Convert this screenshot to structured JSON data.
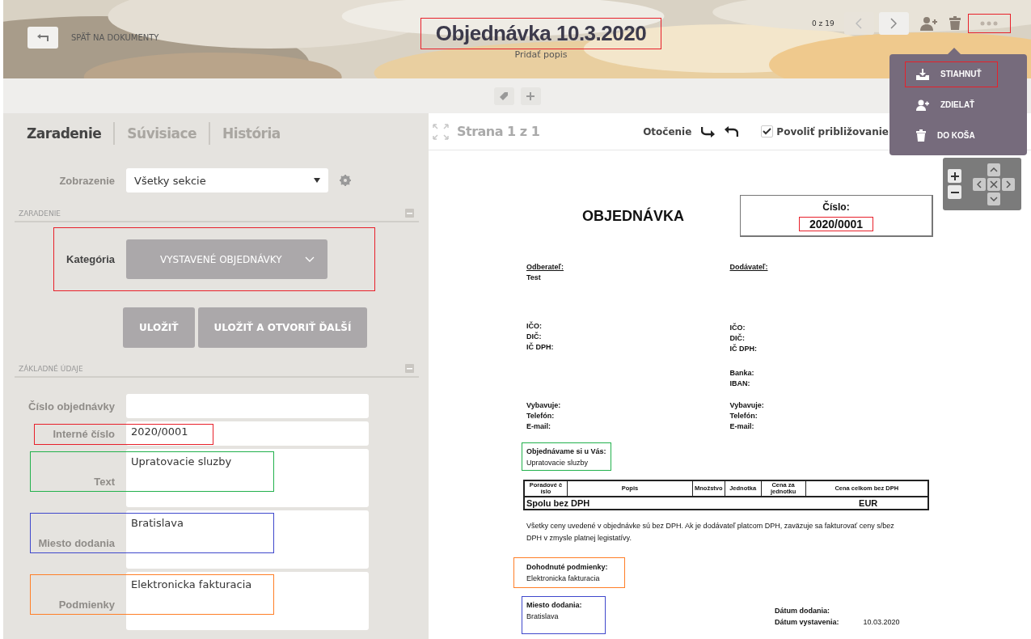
{
  "header": {
    "back_label": "SPÄŤ NA DOKUMENTY",
    "title": "Objednávka 10.3.2020",
    "title_highlight": {
      "color": "#e8202a"
    },
    "subtitle": "Pridať popis",
    "counter": "0 z 19",
    "more_highlight": {
      "color": "#e8202a"
    }
  },
  "more_menu": [
    {
      "label": "STIAHNUŤ",
      "kind": "download",
      "highlight": {
        "color": "#e8202a"
      }
    },
    {
      "label": "ZDIELAŤ",
      "kind": "share"
    },
    {
      "label": "DO KOŠA",
      "kind": "trash"
    }
  ],
  "tabs": [
    {
      "label": "Zaradenie",
      "selected": true
    },
    {
      "label": "Súvisiace",
      "selected": false
    },
    {
      "label": "História",
      "selected": false
    }
  ],
  "view": {
    "label": "Zobrazenie",
    "value": "Všetky sekcie"
  },
  "section_1": "ZARADENIE",
  "category": {
    "label": "Kategória",
    "value": "VYSTAVENÉ OBJEDNÁVKY",
    "highlight": {
      "color": "#e8202a"
    }
  },
  "buttons": [
    "ULOŽIŤ",
    "ULOŽIŤ A OTVORIŤ ĎALŠÍ"
  ],
  "section_2": "ZÁKLADNÉ ÚDAJE",
  "fields": [
    {
      "label": "Číslo objednávky",
      "kind": "line"
    },
    {
      "label": "Interné číslo",
      "value": "2020/0001",
      "kind": "line",
      "highlight": {
        "color": "#e8202a"
      }
    },
    {
      "label": "Text",
      "value": "Upratovacie sluzby",
      "kind": "area",
      "highlight": {
        "color": "#22b14c"
      }
    },
    {
      "label": "Miesto dodania",
      "value": "Bratislava",
      "kind": "area",
      "highlight": {
        "color": "#3f48cc"
      }
    },
    {
      "label": "Podmienky",
      "value": "Elektronicka fakturacia",
      "kind": "area",
      "highlight": {
        "color": "#ff7f27"
      }
    }
  ],
  "viewer": {
    "page": "Strana 1 z 1",
    "rotation_label": "Otočenie",
    "zoom_label": "Povoliť približovanie",
    "zoom_checked": true
  },
  "document": {
    "title": "OBJEDNÁVKA",
    "number_label": "Číslo:",
    "number": "2020/0001",
    "number_highlight": {
      "color": "#e8202a"
    },
    "buyer_label": "Odberateľ:",
    "buyer": "Test",
    "supplier_label": "Dodávateľ:",
    "buyer_ids": [
      "IČO:",
      "DIČ:",
      "IČ DPH:"
    ],
    "supplier_ids": [
      "IČO:",
      "DIČ:",
      "IČ DPH:"
    ],
    "supplier_bank": [
      "Banka:",
      "IBAN:"
    ],
    "buyer_contact": [
      "Vybavuje:",
      "Telefón:",
      "E-mail:"
    ],
    "supplier_contact": [
      "Vybavuje:",
      "Telefón:",
      "E-mail:"
    ],
    "order_label": "Objednávame si u Vás:",
    "order_text": "Upratovacie sluzby",
    "order_highlight": {
      "color": "#22b14c"
    },
    "table_columns": [
      "Poradové č íslo",
      "Popis",
      "Množstvo",
      "Jednotka",
      "Cena za jednotku",
      "Cena celkom bez DPH"
    ],
    "total_label": "Spolu bez DPH",
    "total_currency": "EUR",
    "note": "Všetky ceny uvedené v objednávke sú bez DPH. Ak je dodávateľ platcom DPH, zaväzuje sa fakturovať ceny s/bez DPH v zmysle platnej legistatívy.",
    "terms_label": "Dohodnuté podmienky:",
    "terms_text": "Elektronicka fakturacia",
    "terms_highlight": {
      "color": "#ff7f27"
    },
    "place_label": "Miesto dodania:",
    "place_text": "Bratislava",
    "place_highlight": {
      "color": "#3f48cc"
    },
    "delivery_date_label": "Dátum dodania:",
    "issue_date_label": "Dátum vystavenia:",
    "issue_date": "10.03.2020"
  }
}
